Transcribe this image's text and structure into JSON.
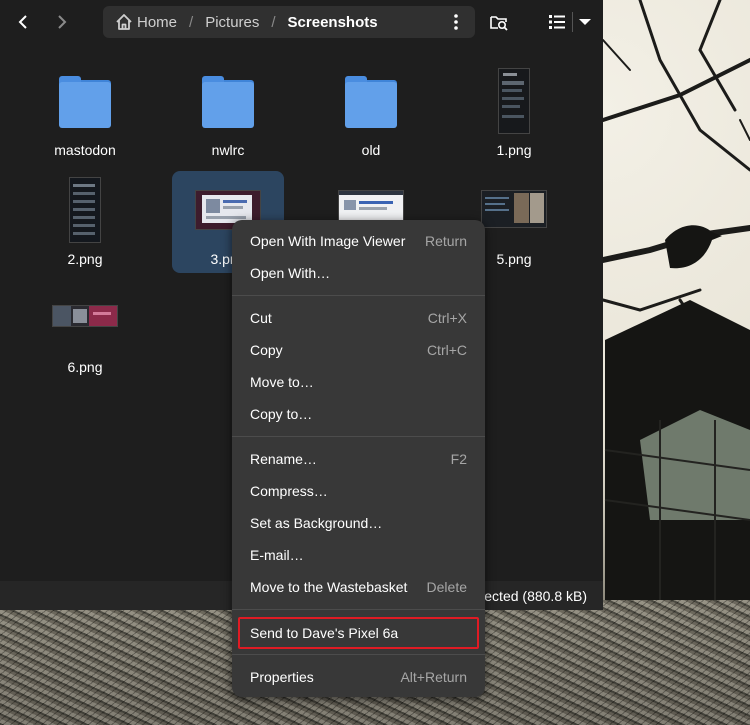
{
  "window": {
    "path": {
      "home": "Home",
      "pictures": "Pictures",
      "current": "Screenshots"
    }
  },
  "files": [
    {
      "name": "mastodon",
      "kind": "folder"
    },
    {
      "name": "nwlrc",
      "kind": "folder"
    },
    {
      "name": "old",
      "kind": "folder"
    },
    {
      "name": "1.png",
      "kind": "image"
    },
    {
      "name": "2.png",
      "kind": "image"
    },
    {
      "name": "3.png",
      "kind": "image",
      "selected": true
    },
    {
      "name": "5.png",
      "kind": "image"
    },
    {
      "name": "6.png",
      "kind": "image"
    }
  ],
  "status": {
    "text": "ected  (880.8 kB)"
  },
  "context_menu": {
    "open_with_viewer": {
      "label": "Open With Image Viewer",
      "accel": "Return"
    },
    "open_with": {
      "label": "Open With…"
    },
    "cut": {
      "label": "Cut",
      "accel": "Ctrl+X"
    },
    "copy": {
      "label": "Copy",
      "accel": "Ctrl+C"
    },
    "move_to": {
      "label": "Move to…"
    },
    "copy_to": {
      "label": "Copy to…"
    },
    "rename": {
      "label": "Rename…",
      "accel": "F2"
    },
    "compress": {
      "label": "Compress…"
    },
    "set_background": {
      "label": "Set as Background…"
    },
    "email": {
      "label": "E-mail…"
    },
    "trash": {
      "label": "Move to the Wastebasket",
      "accel": "Delete"
    },
    "send_to": {
      "label": "Send to Dave's Pixel 6a"
    },
    "properties": {
      "label": "Properties",
      "accel": "Alt+Return"
    }
  },
  "icons": [
    "back-arrow-icon",
    "forward-arrow-icon",
    "home-icon",
    "kebab-menu-icon",
    "search-folder-icon",
    "list-view-icon",
    "chevron-down-icon",
    "folder-icon"
  ],
  "colors": {
    "selection": "#2c4560",
    "folder": "#62a0ea",
    "highlight_border": "#e01b24"
  }
}
